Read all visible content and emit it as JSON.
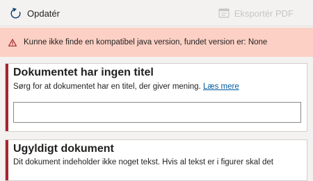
{
  "toolbar": {
    "refresh_label": "Opdatér",
    "refresh_icon": "refresh-icon",
    "export_label": "Eksportér PDF",
    "export_icon": "pdf-icon",
    "export_disabled": true
  },
  "alert": {
    "icon": "warning-icon",
    "message": "Kunne ikke finde en kompatibel java version, fundet version er: None",
    "color": "#fcd0c5"
  },
  "issues": [
    {
      "title": "Dokumentet har ingen titel",
      "description": "Sørg for at dokumentet har en titel, der giver mening.",
      "link_label": "Læs mere",
      "input_value": "",
      "input_placeholder": ""
    },
    {
      "title": "Ugyldigt dokument",
      "description": "Dit dokument indeholder ikke noget tekst. Hvis al tekst er i figurer skal det"
    }
  ],
  "colors": {
    "error_stripe": "#a4262c",
    "link": "#005a9e",
    "disabled": "#c8c6c4"
  }
}
